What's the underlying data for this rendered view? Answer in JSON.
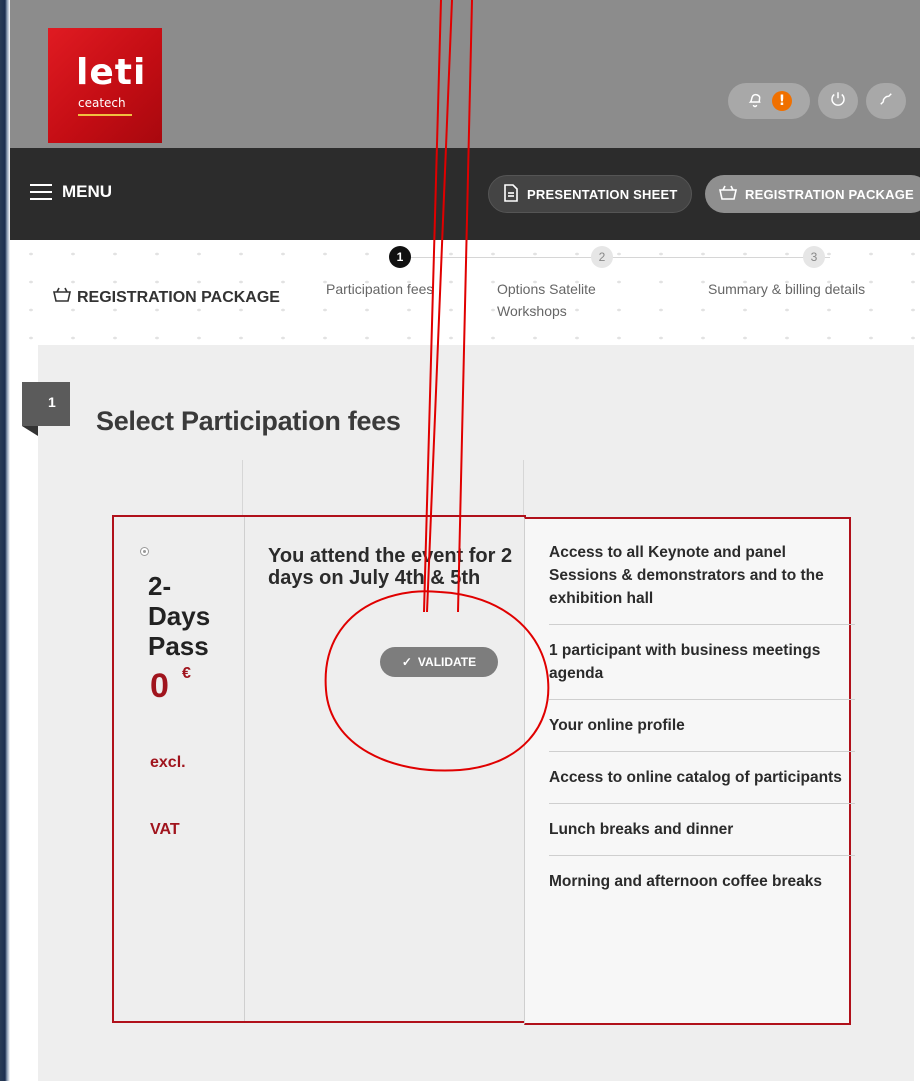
{
  "header": {
    "logo_text": "leti",
    "logo_subtext": "ceatech",
    "icons": [
      "bell-icon",
      "alert-icon",
      "power-icon",
      "phone-icon"
    ],
    "alert_label": "!"
  },
  "nav": {
    "menu_label": "MENU",
    "presentation_label": "PRESENTATION SHEET",
    "registration_label": "REGISTRATION PACKAGE"
  },
  "stepper": {
    "title": "REGISTRATION PACKAGE",
    "steps": [
      {
        "num": "1",
        "label": "Participation fees"
      },
      {
        "num": "2",
        "label": "Options Satelite Workshops"
      },
      {
        "num": "3",
        "label": "Summary & billing details"
      }
    ]
  },
  "section": {
    "number": "1",
    "title": "Select Participation fees"
  },
  "package": {
    "name": "2-Days Pass",
    "name_lines": [
      "2-",
      "Days",
      "Pass"
    ],
    "price": "0",
    "currency": "€",
    "vat_line1": "excl.",
    "vat_line2": "VAT",
    "description": "You attend the event for 2 days on July 4th & 5th",
    "validate_label": "VALIDATE",
    "features": [
      "Access to all Keynote and panel Sessions & demonstrators and to the exhibition hall",
      "1 participant with business meetings agenda",
      "Your online profile",
      "Access to online catalog of participants",
      "Lunch breaks and dinner",
      "Morning and afternoon coffee breaks"
    ]
  },
  "colors": {
    "brand_red": "#c40d14",
    "price_red": "#a0141d",
    "annotation_red": "#e00000",
    "nav_bg": "#2c2c2c",
    "header_bg": "#8c8c8c"
  }
}
